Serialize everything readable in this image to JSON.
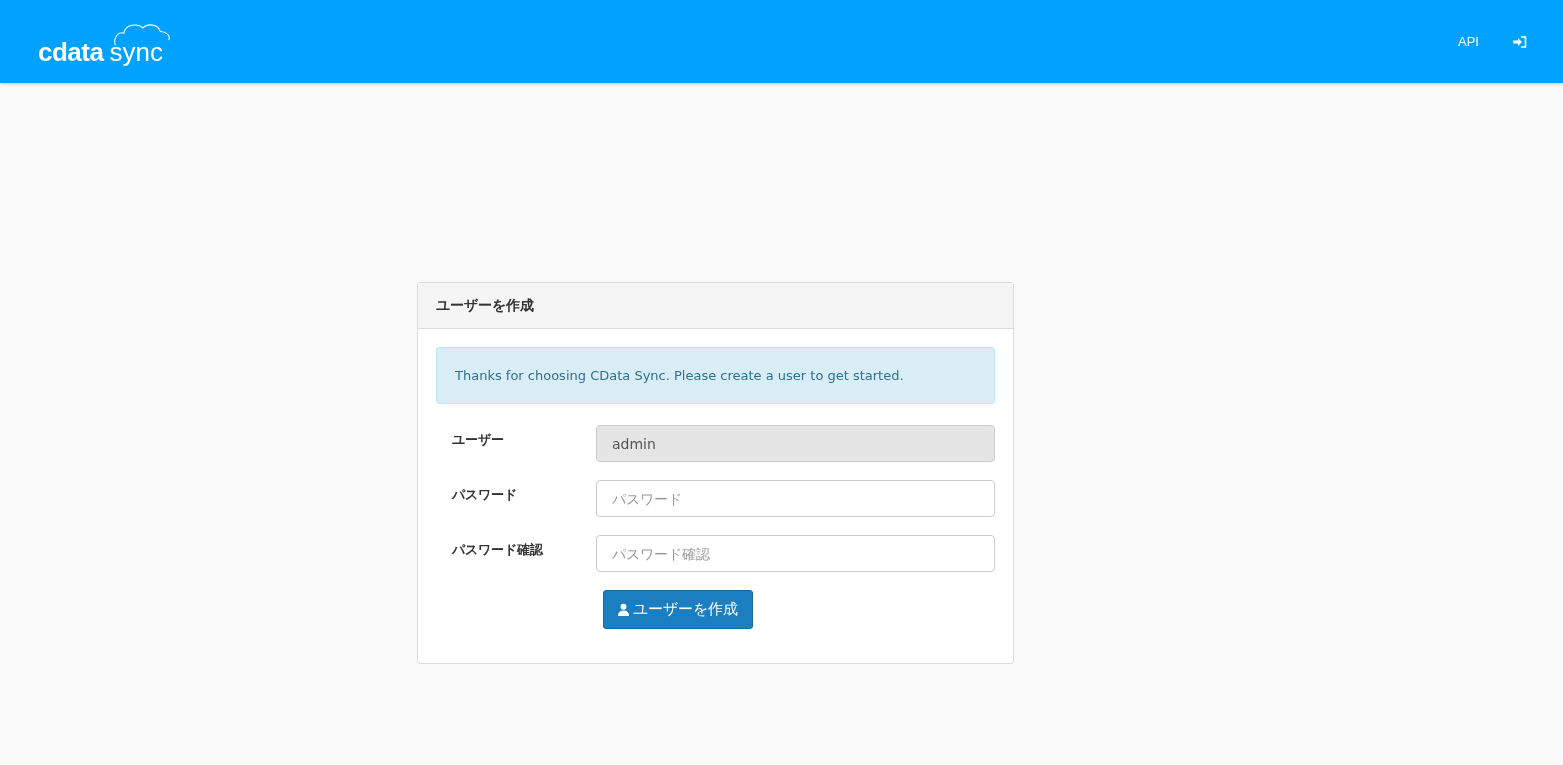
{
  "header": {
    "logo": {
      "brand": "cdata",
      "product": "sync"
    },
    "nav": [
      {
        "kind": "text",
        "label": "API"
      },
      {
        "kind": "icon"
      }
    ]
  },
  "panel": {
    "title": "ユーザーを作成",
    "alert": "Thanks for choosing CData Sync. Please create a user to get started.",
    "fields": [
      {
        "label": "ユーザー",
        "value": "admin",
        "disabled": true
      },
      {
        "label": "パスワード",
        "placeholder": "パスワード",
        "disabled": false
      },
      {
        "label": "パスワード確認",
        "placeholder": "パスワード確認",
        "disabled": false
      }
    ],
    "button": "ユーザーを作成"
  }
}
